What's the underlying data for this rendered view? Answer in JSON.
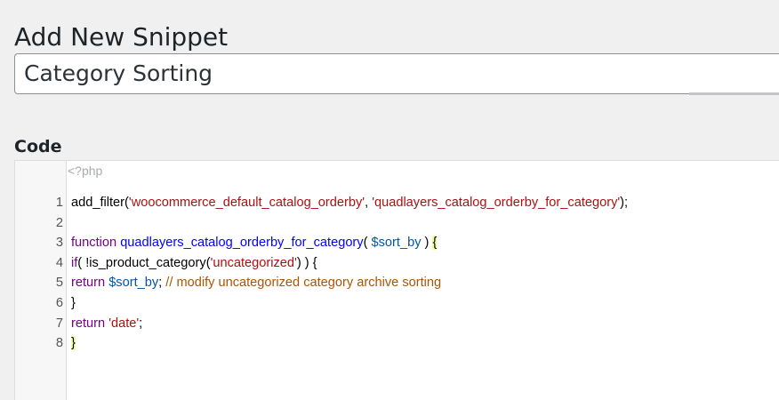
{
  "page": {
    "title": "Add New Snippet"
  },
  "snippet": {
    "title_value": "Category Sorting"
  },
  "code_section": {
    "heading": "Code",
    "php_open_tag": "<?php"
  },
  "editor": {
    "lines": [
      {
        "number": "1",
        "tokens": [
          {
            "text": "add_filter(",
            "type": "plain"
          },
          {
            "text": "'woocommerce_default_catalog_orderby'",
            "type": "str"
          },
          {
            "text": ", ",
            "type": "plain"
          },
          {
            "text": "'quadlayers_catalog_orderby_for_category'",
            "type": "str"
          },
          {
            "text": ");",
            "type": "plain"
          }
        ]
      },
      {
        "number": "2",
        "tokens": []
      },
      {
        "number": "3",
        "tokens": [
          {
            "text": "function",
            "type": "kw"
          },
          {
            "text": " ",
            "type": "plain"
          },
          {
            "text": "quadlayers_catalog_orderby_for_category",
            "type": "def"
          },
          {
            "text": "( ",
            "type": "plain"
          },
          {
            "text": "$sort_by",
            "type": "var"
          },
          {
            "text": " ) ",
            "type": "plain"
          },
          {
            "text": "{",
            "type": "match"
          }
        ]
      },
      {
        "number": "4",
        "tokens": [
          {
            "text": "if",
            "type": "kw"
          },
          {
            "text": "( !is_product_category(",
            "type": "plain"
          },
          {
            "text": "'uncategorized'",
            "type": "str"
          },
          {
            "text": ") ) {",
            "type": "plain"
          }
        ]
      },
      {
        "number": "5",
        "tokens": [
          {
            "text": "return",
            "type": "kw"
          },
          {
            "text": " ",
            "type": "plain"
          },
          {
            "text": "$sort_by",
            "type": "var"
          },
          {
            "text": "; ",
            "type": "plain"
          },
          {
            "text": "// modify uncategorized category archive sorting",
            "type": "cmt"
          }
        ]
      },
      {
        "number": "6",
        "tokens": [
          {
            "text": "}",
            "type": "plain"
          }
        ]
      },
      {
        "number": "7",
        "tokens": [
          {
            "text": "return",
            "type": "kw"
          },
          {
            "text": " ",
            "type": "plain"
          },
          {
            "text": "'date'",
            "type": "str"
          },
          {
            "text": ";",
            "type": "plain"
          }
        ]
      },
      {
        "number": "8",
        "tokens": [
          {
            "text": "}",
            "type": "match"
          }
        ]
      }
    ]
  },
  "colors": {
    "keyword": "#770088",
    "string": "#aa1111",
    "function_def": "#0000ff",
    "variable": "#0055aa",
    "comment": "#aa5500",
    "bracket_match_bg": "#eeffa0"
  }
}
